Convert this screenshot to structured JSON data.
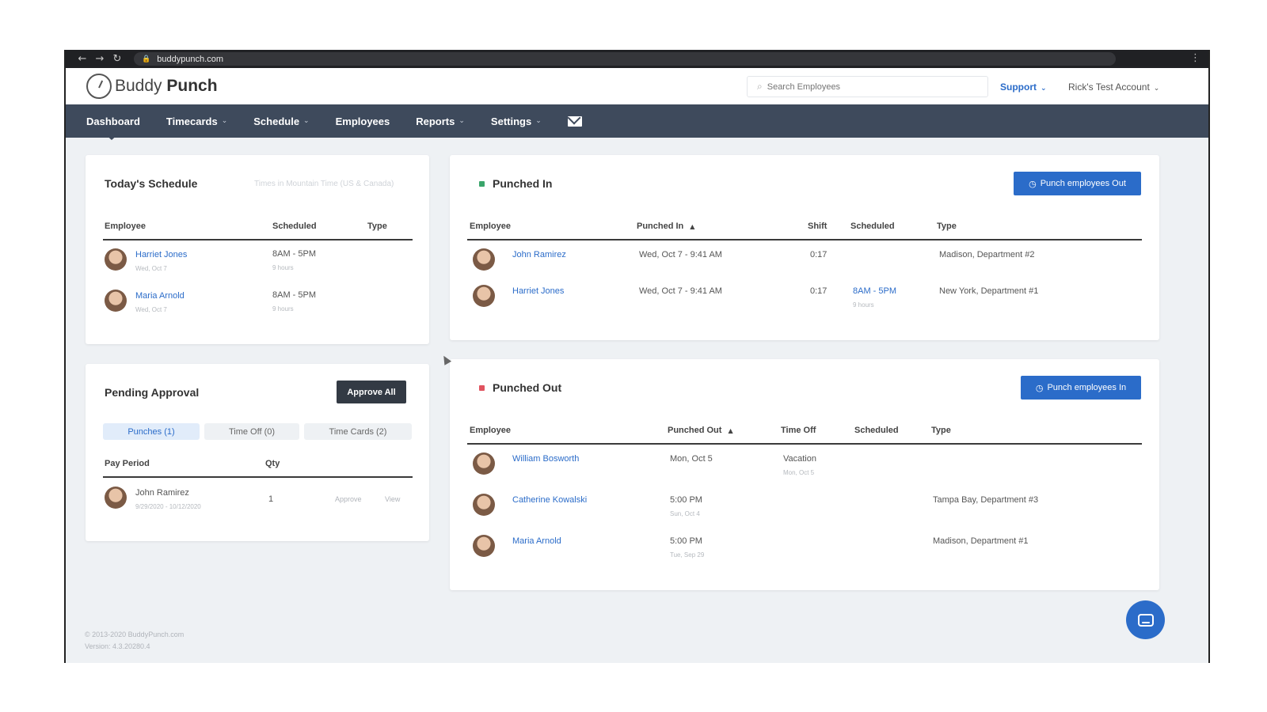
{
  "browser": {
    "url": "buddypunch.com"
  },
  "header": {
    "logo_light": "Buddy ",
    "logo_bold": "Punch",
    "search_placeholder": "Search Employees",
    "support_label": "Support",
    "account_label": "Rick's Test Account"
  },
  "nav": {
    "items": [
      {
        "label": "Dashboard"
      },
      {
        "label": "Timecards"
      },
      {
        "label": "Schedule"
      },
      {
        "label": "Employees"
      },
      {
        "label": "Reports"
      },
      {
        "label": "Settings"
      }
    ]
  },
  "todays_schedule": {
    "title": "Today's Schedule",
    "timezone_note": "Times in Mountain Time (US & Canada)",
    "columns": [
      "Employee",
      "Scheduled",
      "Type"
    ],
    "rows": [
      {
        "name": "Harriet Jones",
        "date": "Wed, Oct 7",
        "scheduled": "8AM - 5PM",
        "hours": "9 hours"
      },
      {
        "name": "Maria Arnold",
        "date": "Wed, Oct 7",
        "scheduled": "8AM - 5PM",
        "hours": "9 hours"
      }
    ]
  },
  "pending_approval": {
    "title": "Pending Approval",
    "approve_all_label": "Approve All",
    "tabs": [
      {
        "label": "Punches (1)"
      },
      {
        "label": "Time Off (0)"
      },
      {
        "label": "Time Cards (2)"
      }
    ],
    "columns": [
      "Pay Period",
      "Qty"
    ],
    "rows": [
      {
        "name": "John Ramirez",
        "period": "9/29/2020 - 10/12/2020",
        "qty": "1",
        "approve": "Approve",
        "view": "View"
      }
    ]
  },
  "punched_in": {
    "title": "Punched In",
    "status_color": "#3aa56b",
    "button_label": "Punch employees Out",
    "columns": [
      "Employee",
      "Punched In",
      "Shift",
      "Scheduled",
      "Type"
    ],
    "rows": [
      {
        "name": "John Ramirez",
        "punched": "Wed, Oct 7 - 9:41 AM",
        "shift": "0:17",
        "scheduled": "",
        "hours": "",
        "type": "Madison, Department #2"
      },
      {
        "name": "Harriet Jones",
        "punched": "Wed, Oct 7 - 9:41 AM",
        "shift": "0:17",
        "scheduled": "8AM - 5PM",
        "hours": "9 hours",
        "type": "New York, Department #1"
      }
    ]
  },
  "punched_out": {
    "title": "Punched Out",
    "status_color": "#e0535f",
    "button_label": "Punch employees In",
    "columns": [
      "Employee",
      "Punched Out",
      "Time Off",
      "Scheduled",
      "Type"
    ],
    "rows": [
      {
        "name": "William Bosworth",
        "punched": "Mon, Oct 5",
        "punched_sub": "",
        "time_off": "Vacation",
        "time_off_sub": "Mon, Oct 5",
        "type": ""
      },
      {
        "name": "Catherine Kowalski",
        "punched": "5:00 PM",
        "punched_sub": "Sun, Oct 4",
        "time_off": "",
        "time_off_sub": "",
        "type": "Tampa Bay, Department #3"
      },
      {
        "name": "Maria Arnold",
        "punched": "5:00 PM",
        "punched_sub": "Tue, Sep 29",
        "time_off": "",
        "time_off_sub": "",
        "type": "Madison, Department #1"
      }
    ]
  },
  "footer": {
    "copyright": "© 2013-2020 BuddyPunch.com",
    "version": "Version: 4.3.20280.4"
  }
}
